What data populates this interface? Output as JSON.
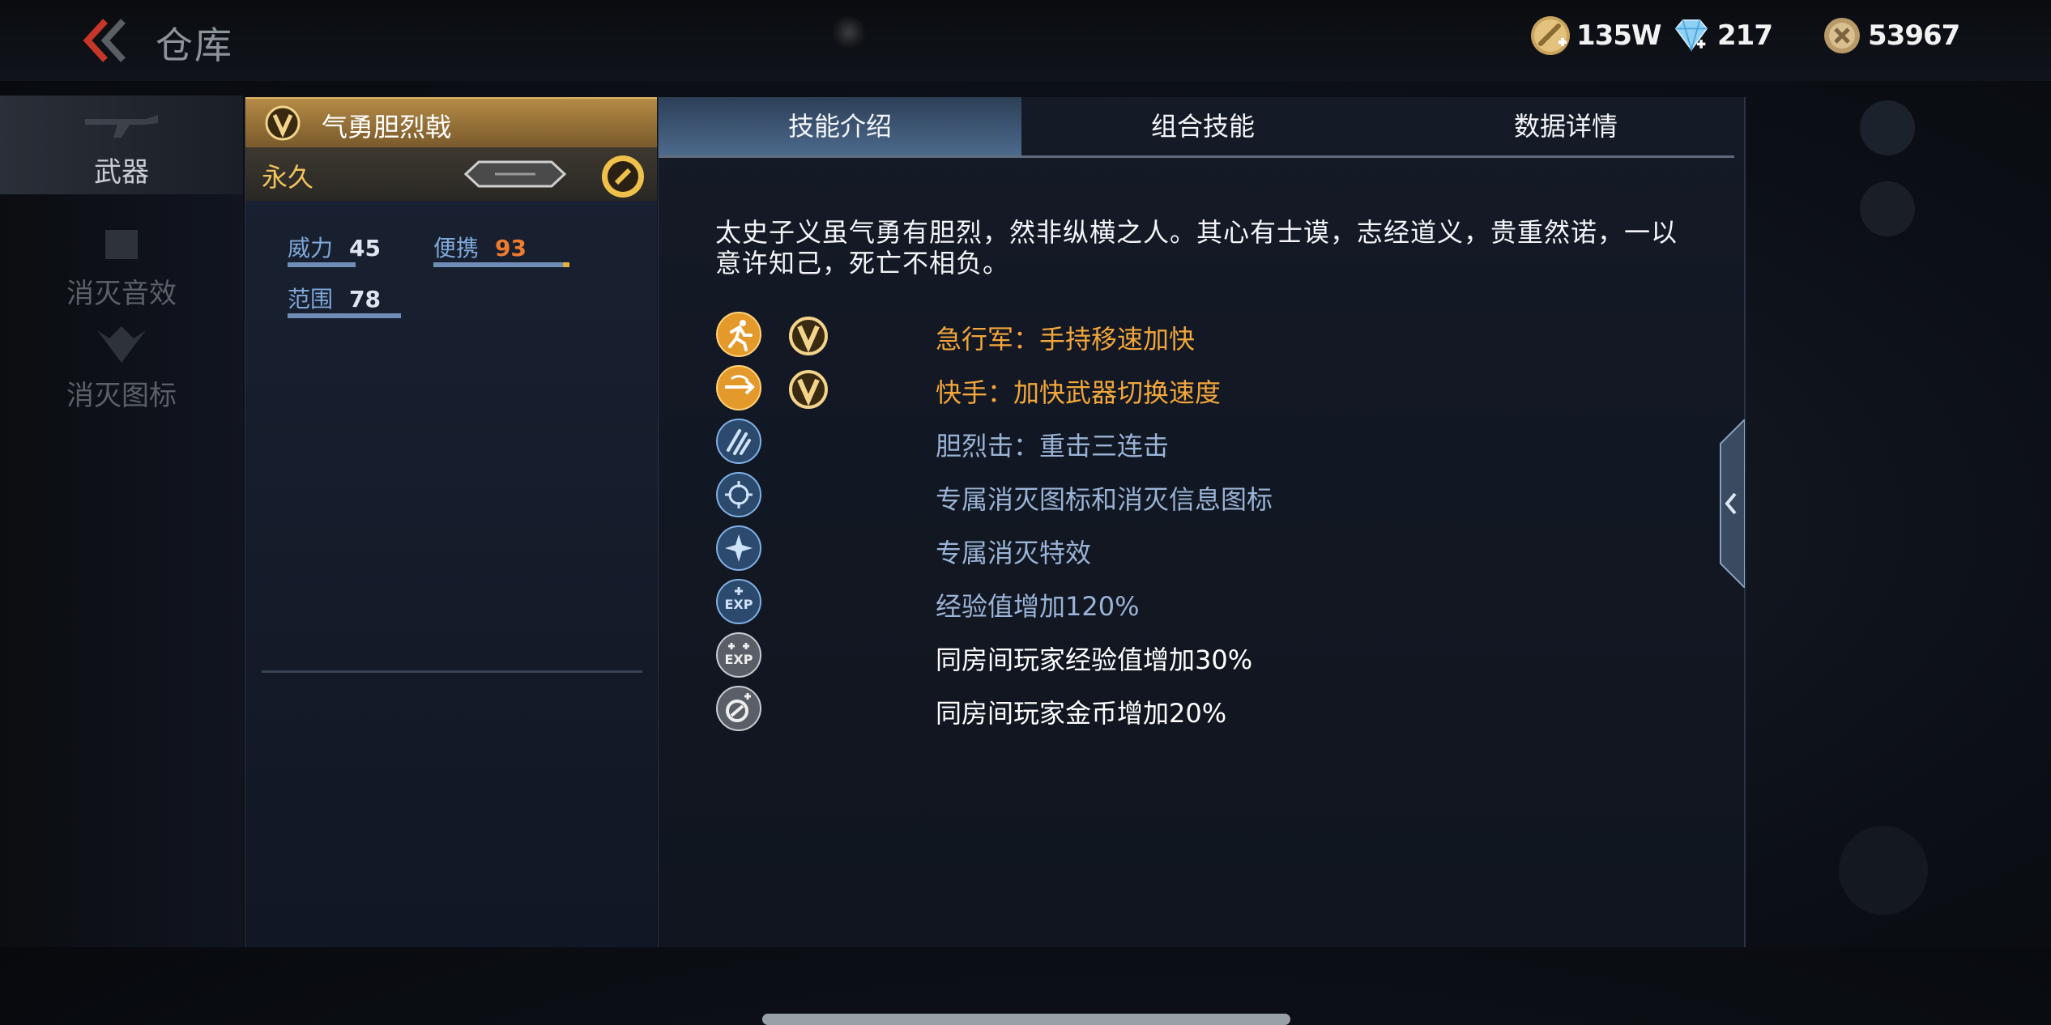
{
  "header": {
    "title": "仓库"
  },
  "currency": [
    {
      "icon": "gold-bar-icon",
      "value": "135W"
    },
    {
      "icon": "diamond-icon",
      "value": "217"
    },
    {
      "icon": "token-coin-icon",
      "value": "53967"
    }
  ],
  "nav": [
    {
      "label": "武器",
      "icon": "rifle-icon",
      "active": true
    },
    {
      "label": "消灭音效",
      "icon": "speaker-icon",
      "active": false
    },
    {
      "label": "消灭图标",
      "icon": "emblem-icon",
      "active": false
    }
  ],
  "item": {
    "name": "气勇胆烈戟",
    "duration": "永久",
    "stats": [
      {
        "label": "威力",
        "value": "45",
        "level": 0.45
      },
      {
        "label": "便携",
        "value": "93",
        "level": 0.93
      },
      {
        "label": "范围",
        "value": "78",
        "level": 0.78
      }
    ]
  },
  "tabs": [
    "技能介绍",
    "组合技能",
    "数据详情"
  ],
  "description": "太史子义虽气勇有胆烈，然非纵横之人。其心有士谟，志经道义，贵重然诺，一以意许知己，死亡不相负。",
  "skills": [
    {
      "icon": "running-man-icon",
      "vip": true,
      "text": "急行军：手持移速加快",
      "color": "gold"
    },
    {
      "icon": "quick-swap-icon",
      "vip": true,
      "text": "快手：加快武器切换速度",
      "color": "gold"
    },
    {
      "icon": "triple-strike-icon",
      "vip": false,
      "text": "胆烈击：重击三连击",
      "color": "blue"
    },
    {
      "icon": "kill-icon-badge",
      "vip": false,
      "text": "专属消灭图标和消灭信息图标",
      "color": "blue"
    },
    {
      "icon": "kill-effect-icon",
      "vip": false,
      "text": "专属消灭特效",
      "color": "blue"
    },
    {
      "icon": "exp-plus-icon",
      "vip": false,
      "text": "经验值增加120%",
      "color": "blue"
    },
    {
      "icon": "room-exp-icon",
      "vip": false,
      "text": "同房间玩家经验值增加30%",
      "color": "white"
    },
    {
      "icon": "room-gold-icon",
      "vip": false,
      "text": "同房间玩家金币增加20%",
      "color": "white"
    }
  ],
  "colors": {
    "gold": "#f2a63b",
    "blue": "#9ab3d6",
    "white": "#ffffff",
    "tab_active": "#4c6a8d"
  }
}
